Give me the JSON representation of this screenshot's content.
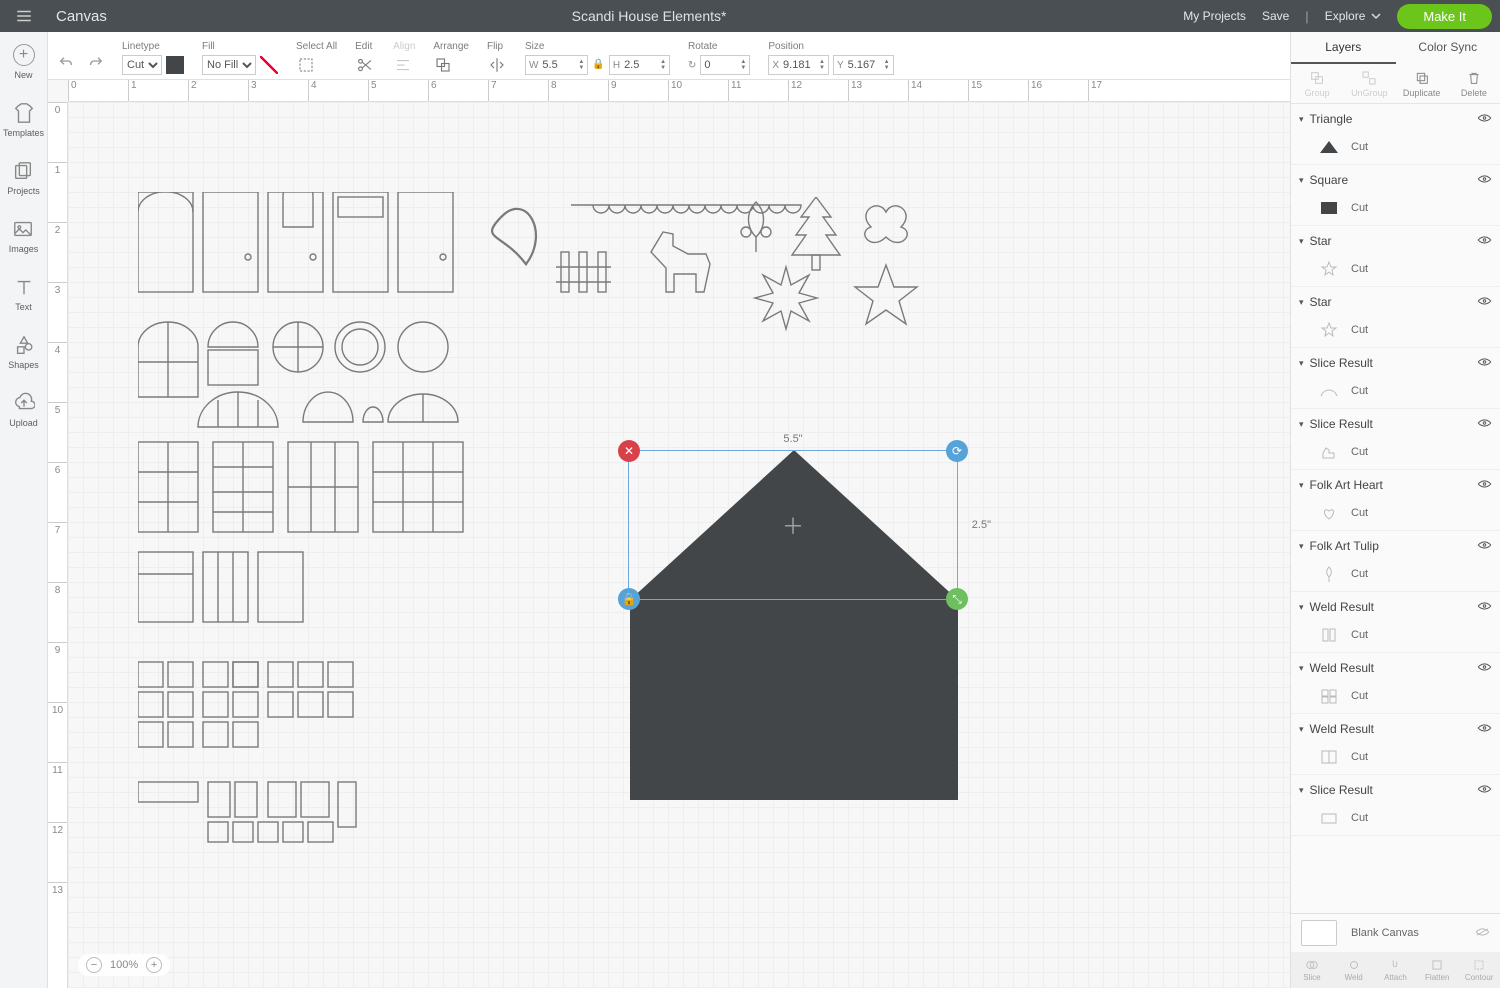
{
  "topbar": {
    "app_name": "Canvas",
    "doc_title": "Scandi House Elements*",
    "my_projects": "My Projects",
    "save": "Save",
    "explore": "Explore",
    "make_it": "Make It"
  },
  "left_tools": [
    {
      "key": "new",
      "label": "New"
    },
    {
      "key": "templates",
      "label": "Templates"
    },
    {
      "key": "projects",
      "label": "Projects"
    },
    {
      "key": "images",
      "label": "Images"
    },
    {
      "key": "text",
      "label": "Text"
    },
    {
      "key": "shapes",
      "label": "Shapes"
    },
    {
      "key": "upload",
      "label": "Upload"
    }
  ],
  "ribbon": {
    "linetype_label": "Linetype",
    "linetype_value": "Cut",
    "fill_label": "Fill",
    "fill_value": "No Fill",
    "select_all": "Select All",
    "edit": "Edit",
    "align": "Align",
    "arrange": "Arrange",
    "flip": "Flip",
    "size": "Size",
    "size_w_label": "W",
    "size_w": "5.5",
    "size_h_label": "H",
    "size_h": "2.5",
    "rotate": "Rotate",
    "rotate_val": "0",
    "position": "Position",
    "pos_x_label": "X",
    "pos_x": "9.181",
    "pos_y_label": "Y",
    "pos_y": "5.167"
  },
  "selection": {
    "width_label": "5.5\"",
    "height_label": "2.5\""
  },
  "zoom": "100%",
  "right": {
    "tabs": {
      "layers": "Layers",
      "color_sync": "Color Sync"
    },
    "actions": {
      "group": "Group",
      "ungroup": "UnGroup",
      "duplicate": "Duplicate",
      "delete": "Delete"
    },
    "layers": [
      {
        "name": "Triangle",
        "op": "Cut",
        "thumb": "triangle-dark"
      },
      {
        "name": "Square",
        "op": "Cut",
        "thumb": "square-dark"
      },
      {
        "name": "Star",
        "op": "Cut",
        "thumb": "star-outline"
      },
      {
        "name": "Star",
        "op": "Cut",
        "thumb": "star-outline2"
      },
      {
        "name": "Slice Result",
        "op": "Cut",
        "thumb": "slice"
      },
      {
        "name": "Slice Result",
        "op": "Cut",
        "thumb": "horse"
      },
      {
        "name": "Folk Art Heart",
        "op": "Cut",
        "thumb": "heart"
      },
      {
        "name": "Folk Art Tulip",
        "op": "Cut",
        "thumb": "tulip"
      },
      {
        "name": "Weld Result",
        "op": "Cut",
        "thumb": "weld1"
      },
      {
        "name": "Weld Result",
        "op": "Cut",
        "thumb": "weld2"
      },
      {
        "name": "Weld Result",
        "op": "Cut",
        "thumb": "weld3"
      },
      {
        "name": "Slice Result",
        "op": "Cut",
        "thumb": "slice2"
      }
    ],
    "blank_canvas": "Blank Canvas",
    "footer": [
      "Slice",
      "Weld",
      "Attach",
      "Flatten",
      "Contour"
    ]
  },
  "ruler_h": [
    "0",
    "1",
    "2",
    "3",
    "4",
    "5",
    "6",
    "7",
    "8",
    "9",
    "10",
    "11",
    "12",
    "13",
    "14",
    "15",
    "16",
    "17"
  ],
  "ruler_v": [
    "0",
    "1",
    "2",
    "3",
    "4",
    "5",
    "6",
    "7",
    "8",
    "9",
    "10",
    "11",
    "12",
    "13"
  ]
}
